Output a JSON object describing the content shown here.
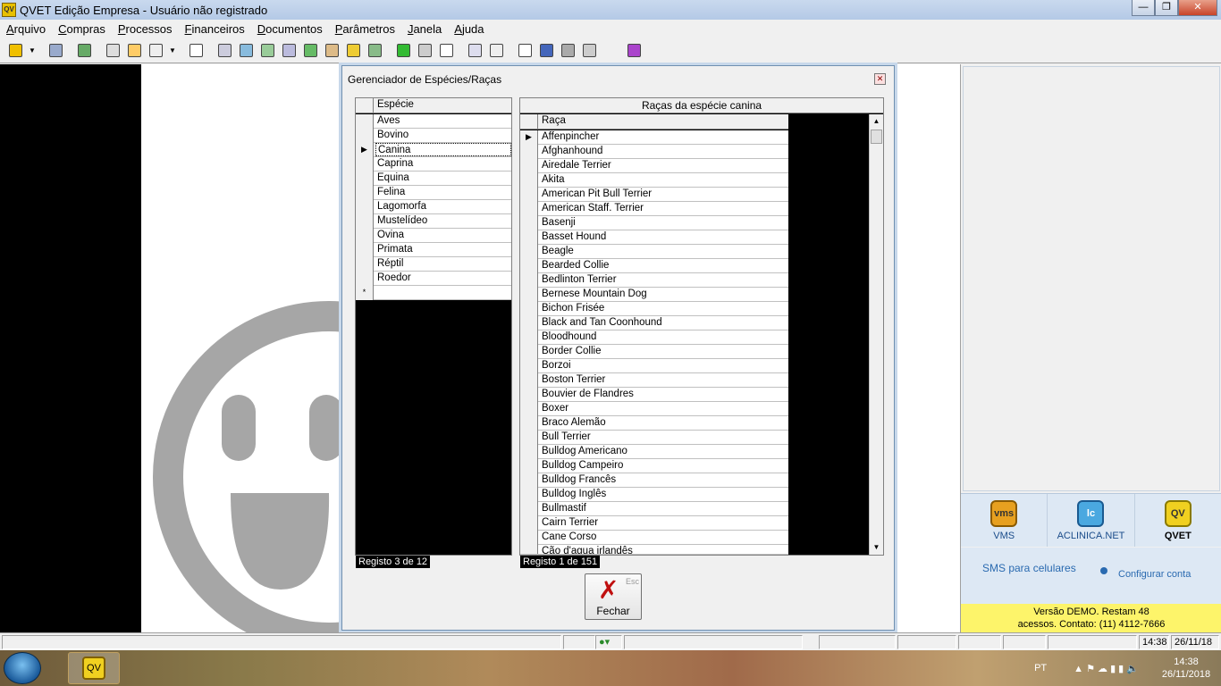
{
  "window": {
    "title": "QVET Edição Empresa - Usuário não registrado",
    "app_icon": "QV"
  },
  "menu": [
    "Arquivo",
    "Compras",
    "Processos",
    "Financeiros",
    "Documentos",
    "Parâmetros",
    "Janela",
    "Ajuda"
  ],
  "dialog": {
    "title": "Gerenciador de Espécies/Raças",
    "species_grid": {
      "header": "Espécie",
      "rows": [
        "Aves",
        "Bovino",
        "Canina",
        "Caprina",
        "Equina",
        "Felina",
        "Lagomorfa",
        "Mustelídeo",
        "Ovina",
        "Primata",
        "Réptil",
        "Roedor"
      ],
      "selected_index": 2,
      "new_row_marker": "*",
      "record_label": "Registo 3 de 12"
    },
    "breeds_grid": {
      "caption": "Raças da espécie canina",
      "header": "Raça",
      "rows": [
        "Affenpincher",
        "Afghanhound",
        "Airedale Terrier",
        "Akita",
        "American Pit Bull Terrier",
        "American Staff. Terrier",
        "Basenji",
        "Basset Hound",
        "Beagle",
        "Bearded Collie",
        "Bedlinton Terrier",
        "Bernese Mountain Dog",
        "Bichon Frisée",
        "Black and Tan Coonhound",
        "Bloodhound",
        "Border Collie",
        "Borzoi",
        "Boston Terrier",
        "Bouvier de Flandres",
        "Boxer",
        "Braco Alemão",
        "Bull Terrier",
        "Bulldog Americano",
        "Bulldog Campeiro",
        "Bulldog Francês",
        "Bulldog Inglês",
        "Bullmastif",
        "Cairn Terrier",
        "Cane Corso",
        "Cão d'agua irlandês"
      ],
      "record_label": "Registo 1 de 151"
    },
    "close_button": {
      "label": "Fechar",
      "shortcut": "Esc",
      "icon": "x-icon"
    }
  },
  "right_panel": {
    "apps": [
      {
        "icon_text": "vms",
        "label": "VMS"
      },
      {
        "icon_text": "lc",
        "label": "ACLINICA.NET"
      },
      {
        "icon_text": "QV",
        "label": "QVET"
      }
    ],
    "sms_title": "SMS para celulares",
    "sms_config": "Configurar conta",
    "demo_line1": "Versão DEMO. Restam 48",
    "demo_line2": "acessos. Contato: (11) 4112-7666"
  },
  "statusbar": {
    "time": "14:38",
    "date": "26/11/18"
  },
  "taskbar": {
    "lang": "PT",
    "clock_time": "14:38",
    "clock_date": "26/11/2018",
    "qvet_label": "QV"
  },
  "colors": {
    "demo_banner": "#fdf46a",
    "accent_blue": "#2a6ab0"
  }
}
